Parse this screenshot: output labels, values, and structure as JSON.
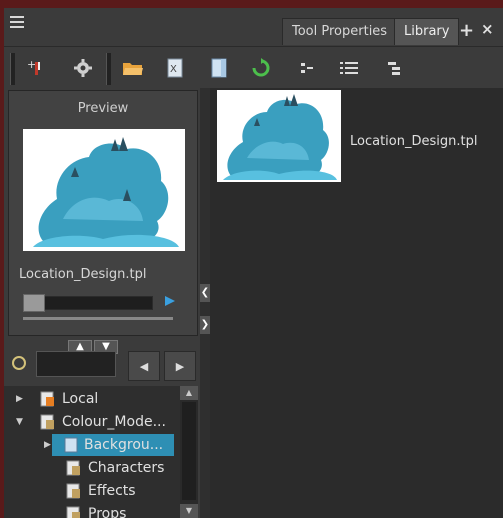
{
  "tabs": {
    "tool_properties": "Tool Properties",
    "library": "Library"
  },
  "toolbar": {
    "icons": [
      "new-library-icon",
      "gear-icon",
      "open-folder-icon",
      "template-icon",
      "page-icon",
      "refresh-icon",
      "collapse-icon",
      "list-view-icon",
      "details-view-icon"
    ]
  },
  "preview": {
    "title": "Preview",
    "file_name": "Location_Design.tpl",
    "progress": 0
  },
  "search": {
    "value": ""
  },
  "tree": {
    "items": [
      {
        "label": "Local"
      },
      {
        "label": "Colour_Mode..."
      },
      {
        "label": "Backgrou..."
      },
      {
        "label": "Characters"
      },
      {
        "label": "Effects"
      },
      {
        "label": "Props"
      }
    ]
  },
  "library_view": {
    "items": [
      {
        "name": "Location_Design.tpl"
      }
    ]
  },
  "colors": {
    "accent": "#3aa0e0",
    "selection": "#2e8fb4",
    "background": "#3b3b3b"
  }
}
